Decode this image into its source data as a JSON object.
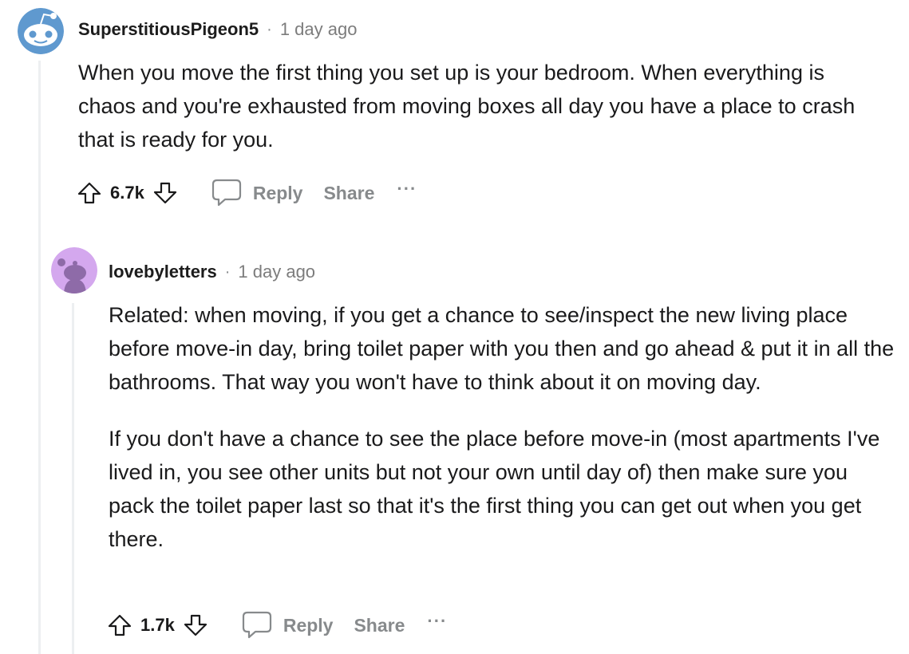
{
  "comments": [
    {
      "author": "SuperstitiousPigeon5",
      "separator": "·",
      "time": "1 day ago",
      "paragraphs": [
        "When you move the first thing you set up is your bedroom. When everything is chaos and you're exhausted from moving boxes all day you have a place to crash that is ready for you."
      ],
      "score": "6.7k",
      "reply_label": "Reply",
      "share_label": "Share",
      "more_label": "···",
      "avatar_icon": "snoo-avatar-icon",
      "avatar_color": "#5f99cf"
    },
    {
      "author": "lovebyletters",
      "separator": "·",
      "time": "1 day ago",
      "paragraphs": [
        "Related: when moving, if you get a chance to see/inspect the new living place before move-in day, bring toilet paper with you then and go ahead & put it in all the bathrooms. That way you won't have to think about it on moving day.",
        "If you don't have a chance to see the place before move-in (most apartments I've lived in, you see other units but not your own until day of) then make sure you pack the toilet paper last so that it's the first thing you can get out when you get there."
      ],
      "score": "1.7k",
      "reply_label": "Reply",
      "share_label": "Share",
      "more_label": "···",
      "avatar_icon": "snoo-avatar-icon",
      "avatar_color": "#d4a8ee"
    }
  ],
  "colors": {
    "thread_line": "#edeff1",
    "action_text": "#878a8c",
    "text": "#1a1a1b"
  }
}
